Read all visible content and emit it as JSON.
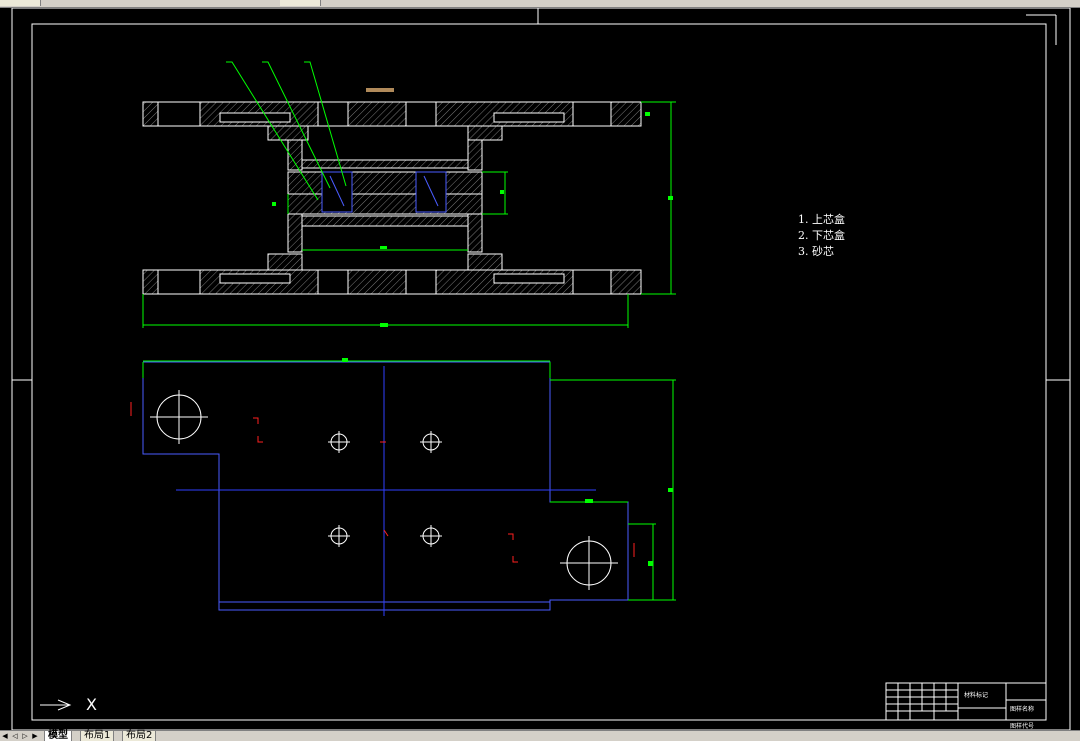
{
  "app": {
    "background": "#000000",
    "accent_green": "#00ff00",
    "line_blue": "#4a5cff",
    "hatch_gray": "#a0a0a0"
  },
  "bom": {
    "items": [
      "1. 上芯盒",
      "2. 下芯盒",
      "3. 砂芯"
    ]
  },
  "ucs": {
    "x_label": "X"
  },
  "title_block": {
    "material_label": "材料标记",
    "drawing_name_label": "图样名称",
    "drawing_code_label": "图样代号"
  },
  "tabs": [
    {
      "label": "模型",
      "active": true
    },
    {
      "label": "布局1",
      "active": false
    },
    {
      "label": "布局2",
      "active": false
    }
  ]
}
